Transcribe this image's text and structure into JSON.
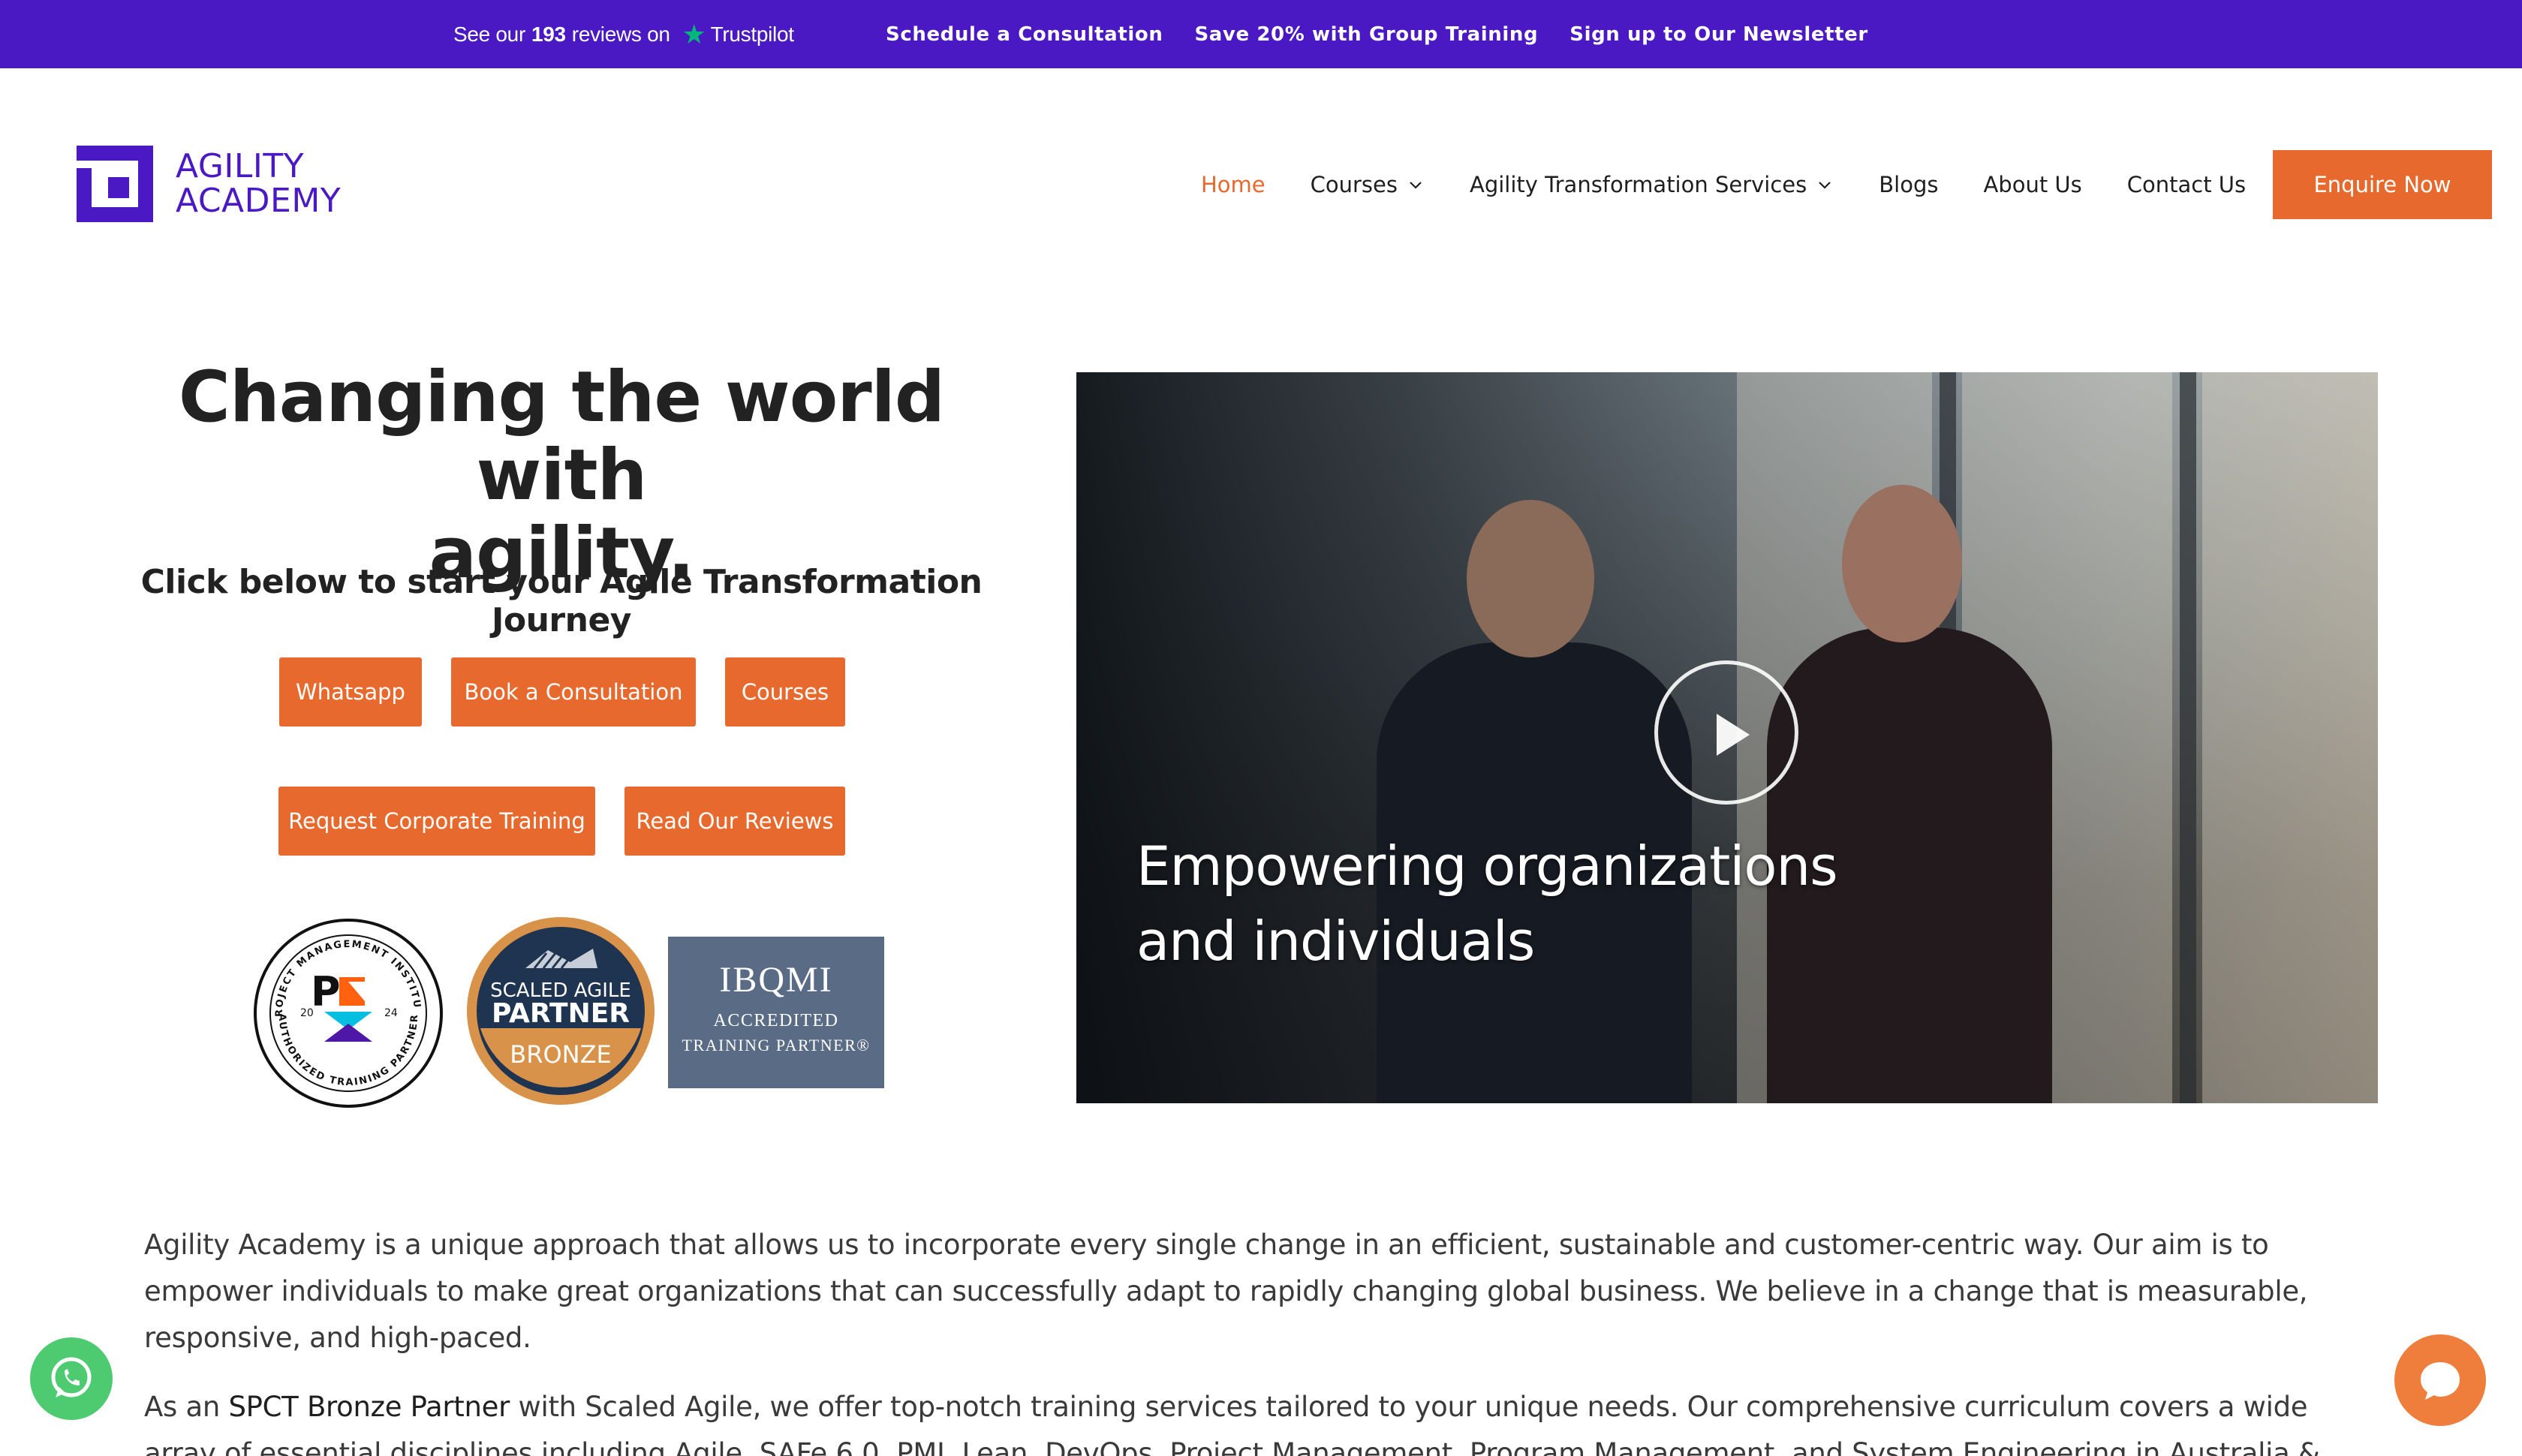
{
  "topbar": {
    "trustpilot": {
      "prefix": "See our",
      "count": "193",
      "suffix": "reviews on",
      "brand": "Trustpilot"
    },
    "links": [
      "Schedule a Consultation",
      "Save 20% with Group Training",
      "Sign up to Our Newsletter"
    ]
  },
  "logo": {
    "line1": "AGILITY",
    "line2": "ACADEMY"
  },
  "nav": {
    "items": [
      {
        "label": "Home",
        "active": true
      },
      {
        "label": "Courses",
        "dropdown": true
      },
      {
        "label": "Agility Transformation Services",
        "dropdown": true
      },
      {
        "label": "Blogs"
      },
      {
        "label": "About Us"
      },
      {
        "label": "Contact Us"
      }
    ],
    "cta": "Enquire Now"
  },
  "hero": {
    "title_line1": "Changing the world with",
    "title_line2": "agility.",
    "subtitle": "Click below to start your Agile Transformation Journey",
    "buttons": [
      "Whatsapp",
      "Book a Consultation",
      "Courses",
      "Request Corporate Training",
      "Read Our Reviews"
    ]
  },
  "badges": {
    "pmi": {
      "ring_top": "PROJECT MANAGEMENT INSTITUTE",
      "ring_bottom": "AUTHORIZED TRAINING PARTNER",
      "year_left": "20",
      "year_right": "24"
    },
    "safe": {
      "line1": "SCALED AGILE",
      "line2": "PARTNER",
      "line3": "BRONZE"
    },
    "ibqmi": {
      "line1": "IBQMI",
      "line2": "ACCREDITED",
      "line3": "TRAINING PARTNER®"
    }
  },
  "video": {
    "caption_line1": "Empowering organizations",
    "caption_line2": "and individuals"
  },
  "body": {
    "para1": "Agility Academy is a unique approach that allows us to incorporate every single change in an efficient, sustainable and customer-centric way. Our aim is to empower individuals to make great organizations that can successfully adapt to rapidly changing global business. We believe in a change that is measurable, responsive, and high-paced.",
    "para2_prefix": "As an",
    "para2_strong": "SPCT Bronze Partner",
    "para2_rest": "with Scaled Agile, we offer top-notch training services tailored to your unique needs. Our comprehensive curriculum covers a wide array of essential disciplines including Agile, SAFe 6.0, PMI, Lean, DevOps, Project Management, Program Management, and System Engineering in Australia & India."
  },
  "colors": {
    "brand_purple": "#4a19c4",
    "accent_orange": "#e8692e",
    "whatsapp_green": "#4ecb71"
  }
}
